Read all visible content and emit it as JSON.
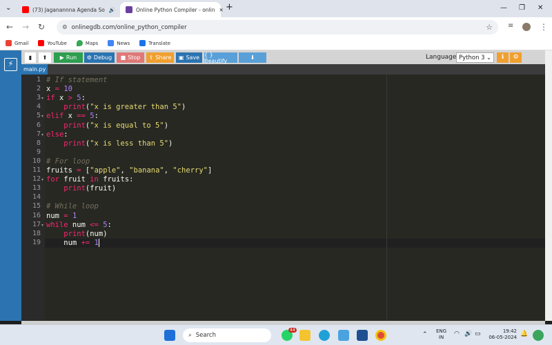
{
  "browser": {
    "tabs": [
      {
        "title": "(73) Jaganannna Agenda So",
        "icon": "youtube-icon"
      },
      {
        "title": "Online Python Compiler - onlin",
        "icon": "onlinegdb-icon"
      }
    ],
    "url": "onlinegdb.com/online_python_compiler",
    "bookmarks": [
      "Gmail",
      "YouTube",
      "Maps",
      "News",
      "Translate"
    ]
  },
  "toolbar": {
    "run": "Run",
    "debug": "Debug",
    "stop": "Stop",
    "share": "Share",
    "save": "Save",
    "beautify": "{ } Beautify",
    "language_label": "Language",
    "language_value": "Python 3"
  },
  "file_tab": "main.py",
  "code": {
    "line_numbers": [
      "1",
      "2",
      "3",
      "4",
      "5",
      "6",
      "7",
      "8",
      "9",
      "10",
      "11",
      "12",
      "13",
      "14",
      "15",
      "16",
      "17",
      "18",
      "19"
    ],
    "lines": [
      "# If statement",
      "x = 10",
      "if x > 5:",
      "    print(\"x is greater than 5\")",
      "elif x == 5:",
      "    print(\"x is equal to 5\")",
      "else:",
      "    print(\"x is less than 5\")",
      "",
      "# For loop",
      "fruits = [\"apple\", \"banana\", \"cherry\"]",
      "for fruit in fruits:",
      "    print(fruit)",
      "",
      "# While loop",
      "num = 1",
      "while num <= 5:",
      "    print(num)",
      "    num += 1"
    ]
  },
  "taskbar": {
    "search_placeholder": "Search",
    "lang": "ENG",
    "region": "IN",
    "time": "19:42",
    "date": "06-05-2024",
    "badge": "44"
  }
}
